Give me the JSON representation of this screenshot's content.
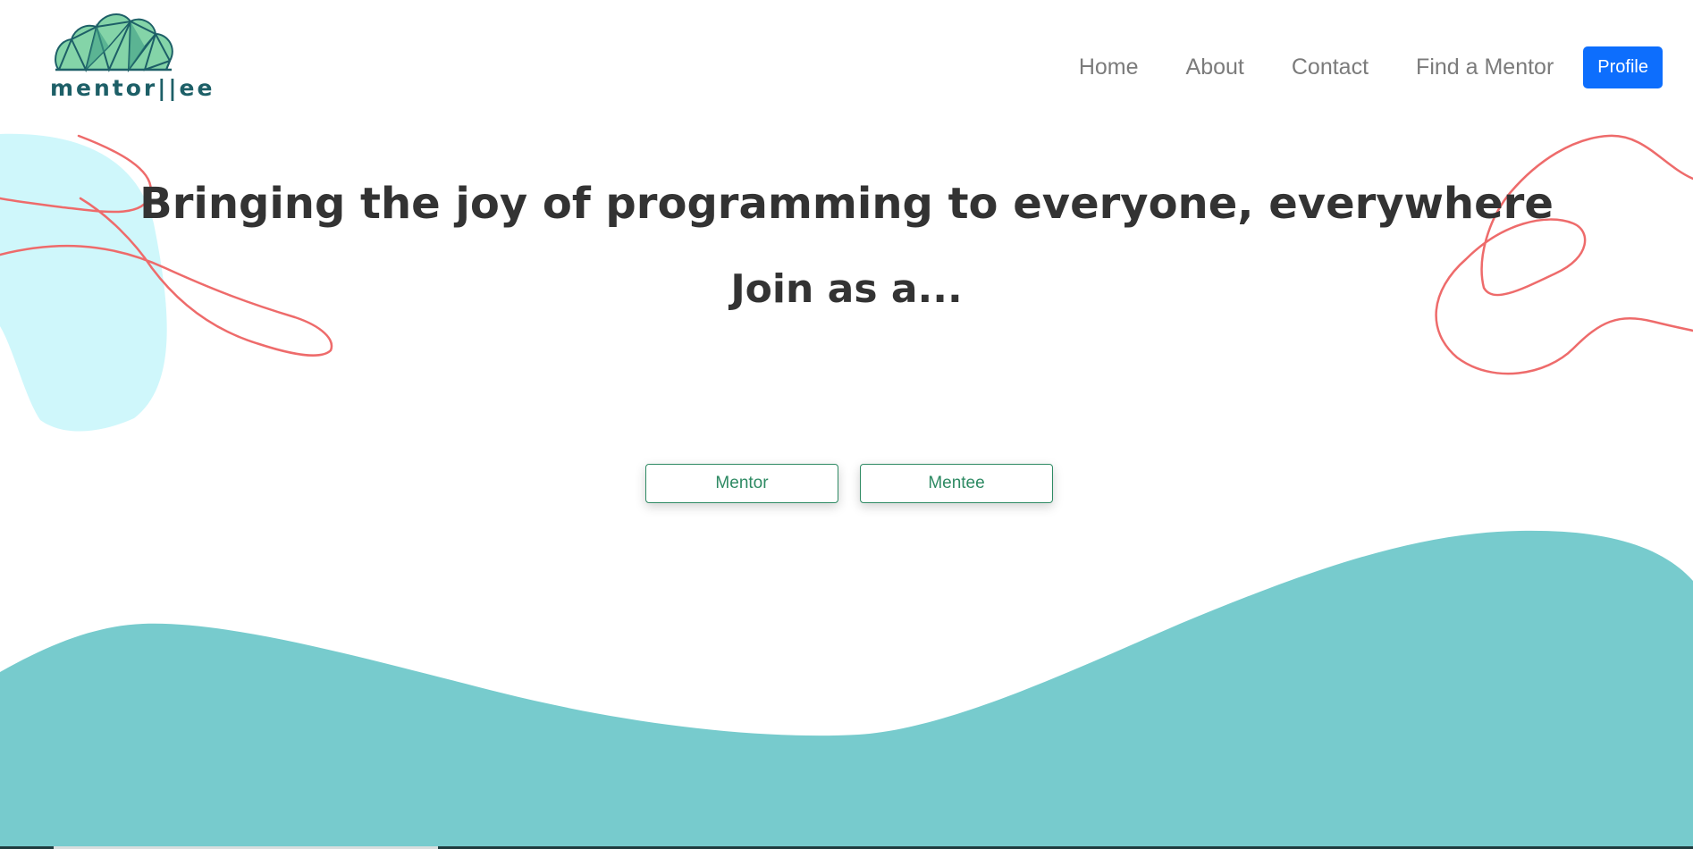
{
  "brand": {
    "name": "mentor||ee"
  },
  "nav": {
    "links": [
      {
        "label": "Home"
      },
      {
        "label": "About"
      },
      {
        "label": "Contact"
      },
      {
        "label": "Find a Mentor"
      }
    ],
    "profile_label": "Profile"
  },
  "hero": {
    "headline": "Bringing the joy of programming to everyone, everywhere",
    "subheadline": "Join as a..."
  },
  "join": {
    "mentor_label": "Mentor",
    "mentee_label": "Mentee"
  },
  "colors": {
    "primary": "#0d6efd",
    "accent_green": "#2e8a63",
    "wave_teal": "#77cbcd",
    "blob_light_cyan": "#cff7fb",
    "squiggle_red": "#ee6b6b",
    "logo_teal": "#1d5f67",
    "heading_text": "#333333",
    "nav_text": "#7b7b7b"
  }
}
